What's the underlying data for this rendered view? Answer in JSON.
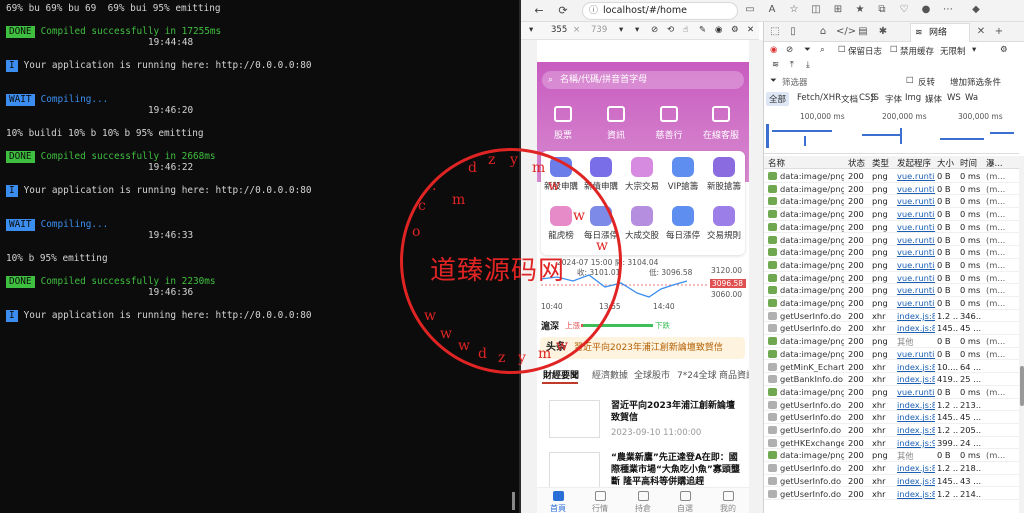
{
  "terminal": {
    "lines": [
      {
        "text": "69% bu 69% bu 69  69% bui 95% emitting",
        "kind": "plain"
      },
      {
        "badge": "DONE",
        "text": "Compiled successfully in 17255ms",
        "kind": "done"
      },
      {
        "text": "19:44:48",
        "kind": "time"
      },
      {
        "badge": "I",
        "text": "Your application is running here: http://0.0.0.0:80",
        "kind": "info"
      },
      {
        "badge": "WAIT",
        "text": "Compiling...",
        "kind": "wait"
      },
      {
        "text": "19:46:20",
        "kind": "time"
      },
      {
        "text": "10% buildi 10% b 10% b 95% emitting",
        "kind": "plain"
      },
      {
        "badge": "DONE",
        "text": "Compiled successfully in 2668ms",
        "kind": "done"
      },
      {
        "text": "19:46:22",
        "kind": "time"
      },
      {
        "badge": "I",
        "text": "Your application is running here: http://0.0.0.0:80",
        "kind": "info"
      },
      {
        "badge": "WAIT",
        "text": "Compiling...",
        "kind": "wait"
      },
      {
        "text": "19:46:33",
        "kind": "time"
      },
      {
        "text": "10% b 95% emitting",
        "kind": "plain"
      },
      {
        "badge": "DONE",
        "text": "Compiled successfully in 2230ms",
        "kind": "done"
      },
      {
        "text": "19:46:36",
        "kind": "time"
      },
      {
        "badge": "I",
        "text": "Your application is running here: http://0.0.0.0:80",
        "kind": "info"
      }
    ]
  },
  "browser": {
    "url": "localhost/#/home",
    "device_width": "355",
    "device_height": "739"
  },
  "phone": {
    "search_placeholder": "名稱/代碼/拼音首字母",
    "hero_nav": [
      "股票",
      "資訊",
      "慈善行",
      "在線客服"
    ],
    "grid": [
      "新股申購",
      "新債申購",
      "大宗交易",
      "VIP搶籌",
      "新股搶籌",
      "龍虎榜",
      "每日漲停",
      "大成交股",
      "每日漲停",
      "交易規則"
    ],
    "chart": {
      "date": "2024-07 15:00",
      "open": "開: 3104.04",
      "close": "收: 3101.01",
      "low": "低: 3096.58",
      "y_labels": [
        "3120.00",
        "3096.58",
        "3060.00"
      ],
      "x_labels": [
        "10:40",
        "13:55",
        "14:40"
      ]
    },
    "quote": {
      "name": "滬深",
      "up": "上漲",
      "down": "下跌"
    },
    "headline": {
      "label": "头条",
      "text": "習近平向2023年浦江創新論壇致賀信"
    },
    "tabs": [
      "財經要聞",
      "經濟數據",
      "全球股市",
      "7*24全球",
      "商品資訊"
    ],
    "news": [
      {
        "title": "習近平向2023年浦江創新論壇致賀信",
        "date": "2023-09-10 11:00:00"
      },
      {
        "title": "“農業新鷹”先正達登A在即：國際種業市場“大魚吃小魚”寡頭壟斷 隆平高科等併購追趕",
        "date": ""
      }
    ],
    "tabbar": [
      "首頁",
      "行情",
      "持倉",
      "自選",
      "我的"
    ]
  },
  "devtools": {
    "tab_network": "网络",
    "toolbar": {
      "preserve_log": "保留日志",
      "disable_cache": "禁用缓存",
      "throttle": "无限制"
    },
    "filter": {
      "placeholder": "筛选器",
      "invert": "反转",
      "more": "增加筛选条件"
    },
    "types": [
      "全部",
      "Fetch/XHR",
      "文档",
      "CSS",
      "JS",
      "字体",
      "Img",
      "媒体",
      "WS",
      "Wa"
    ],
    "overview": [
      "100,000 ms",
      "200,000 ms",
      "300,000 ms"
    ],
    "columns": [
      "名称",
      "状态",
      "类型",
      "发起程序",
      "大小",
      "时间",
      "瀑..."
    ],
    "rows": [
      {
        "name": "data:image/png;...",
        "status": "200",
        "type": "png",
        "initiator": "vue.runtim",
        "size": "0 B",
        "time": "0 ms",
        "wf": "(m..."
      },
      {
        "name": "data:image/png;...",
        "status": "200",
        "type": "png",
        "initiator": "vue.runtim",
        "size": "0 B",
        "time": "0 ms",
        "wf": "(m..."
      },
      {
        "name": "data:image/png;...",
        "status": "200",
        "type": "png",
        "initiator": "vue.runtim",
        "size": "0 B",
        "time": "0 ms",
        "wf": "(m..."
      },
      {
        "name": "data:image/png;...",
        "status": "200",
        "type": "png",
        "initiator": "vue.runtim",
        "size": "0 B",
        "time": "0 ms",
        "wf": "(m..."
      },
      {
        "name": "data:image/png;...",
        "status": "200",
        "type": "png",
        "initiator": "vue.runtim",
        "size": "0 B",
        "time": "0 ms",
        "wf": "(m..."
      },
      {
        "name": "data:image/png;...",
        "status": "200",
        "type": "png",
        "initiator": "vue.runtim",
        "size": "0 B",
        "time": "0 ms",
        "wf": "(m..."
      },
      {
        "name": "data:image/png;...",
        "status": "200",
        "type": "png",
        "initiator": "vue.runtim",
        "size": "0 B",
        "time": "0 ms",
        "wf": "(m..."
      },
      {
        "name": "data:image/png;...",
        "status": "200",
        "type": "png",
        "initiator": "vue.runtim",
        "size": "0 B",
        "time": "0 ms",
        "wf": "(m..."
      },
      {
        "name": "data:image/png;...",
        "status": "200",
        "type": "png",
        "initiator": "vue.runtim",
        "size": "0 B",
        "time": "0 ms",
        "wf": "(m..."
      },
      {
        "name": "data:image/png;...",
        "status": "200",
        "type": "png",
        "initiator": "vue.runtim",
        "size": "0 B",
        "time": "0 ms",
        "wf": "(m..."
      },
      {
        "name": "data:image/png;...",
        "status": "200",
        "type": "png",
        "initiator": "vue.runtim",
        "size": "0 B",
        "time": "0 ms",
        "wf": "(m..."
      },
      {
        "name": "getUserInfo.do",
        "status": "200",
        "type": "xhr",
        "initiator": "index.js:82",
        "size": "1.2 ...",
        "time": "346...",
        "wf": ""
      },
      {
        "name": "getUserInfo.do",
        "status": "200",
        "type": "xhr",
        "initiator": "index.js:82",
        "size": "145...",
        "time": "45 ...",
        "wf": ""
      },
      {
        "name": "data:image/png;...",
        "status": "200",
        "type": "png",
        "initiator": "其他",
        "size": "0 B",
        "time": "0 ms",
        "wf": "(m..."
      },
      {
        "name": "data:image/png;...",
        "status": "200",
        "type": "png",
        "initiator": "vue.runtim",
        "size": "0 B",
        "time": "0 ms",
        "wf": "(m..."
      },
      {
        "name": "getMinK_Echart...",
        "status": "200",
        "type": "xhr",
        "initiator": "index.js:82",
        "size": "10....",
        "time": "64 ...",
        "wf": ""
      },
      {
        "name": "getBankInfo.do",
        "status": "200",
        "type": "xhr",
        "initiator": "index.js:82",
        "size": "419...",
        "time": "25 ...",
        "wf": ""
      },
      {
        "name": "data:image/png;...",
        "status": "200",
        "type": "png",
        "initiator": "vue.runtim",
        "size": "0 B",
        "time": "0 ms",
        "wf": "(m..."
      },
      {
        "name": "getUserInfo.do",
        "status": "200",
        "type": "xhr",
        "initiator": "index.js:82",
        "size": "1.2 ...",
        "time": "213...",
        "wf": ""
      },
      {
        "name": "getUserInfo.do",
        "status": "200",
        "type": "xhr",
        "initiator": "index.js:82",
        "size": "145...",
        "time": "45 ...",
        "wf": ""
      },
      {
        "name": "getUserInfo.do",
        "status": "200",
        "type": "xhr",
        "initiator": "index.js:82",
        "size": "1.2 ...",
        "time": "205...",
        "wf": ""
      },
      {
        "name": "getHKExchange...",
        "status": "200",
        "type": "xhr",
        "initiator": "index.js:99",
        "size": "399...",
        "time": "24 ...",
        "wf": ""
      },
      {
        "name": "data:image/png;...",
        "status": "200",
        "type": "png",
        "initiator": "其他",
        "size": "0 B",
        "time": "0 ms",
        "wf": "(m..."
      },
      {
        "name": "getUserInfo.do",
        "status": "200",
        "type": "xhr",
        "initiator": "index.js:82",
        "size": "1.2 ...",
        "time": "218...",
        "wf": ""
      },
      {
        "name": "getUserInfo.do",
        "status": "200",
        "type": "xhr",
        "initiator": "index.js:82",
        "size": "145...",
        "time": "43 ...",
        "wf": ""
      },
      {
        "name": "getUserInfo.do",
        "status": "200",
        "type": "xhr",
        "initiator": "index.js:82",
        "size": "1.2 ...",
        "time": "214...",
        "wf": ""
      }
    ]
  },
  "watermark": {
    "text": "道臻源码网",
    "chars_top": "dzym",
    "chars_bottom": "wwwdzymw",
    "chars_side": "www.com"
  },
  "colors": {
    "terminal_bg": "#0c0c0c",
    "done": "#3fbf3f",
    "wait": "#3b8ef0",
    "brand": "#c85bc0",
    "watermark": "#e02424",
    "link": "#1a5fb4"
  }
}
